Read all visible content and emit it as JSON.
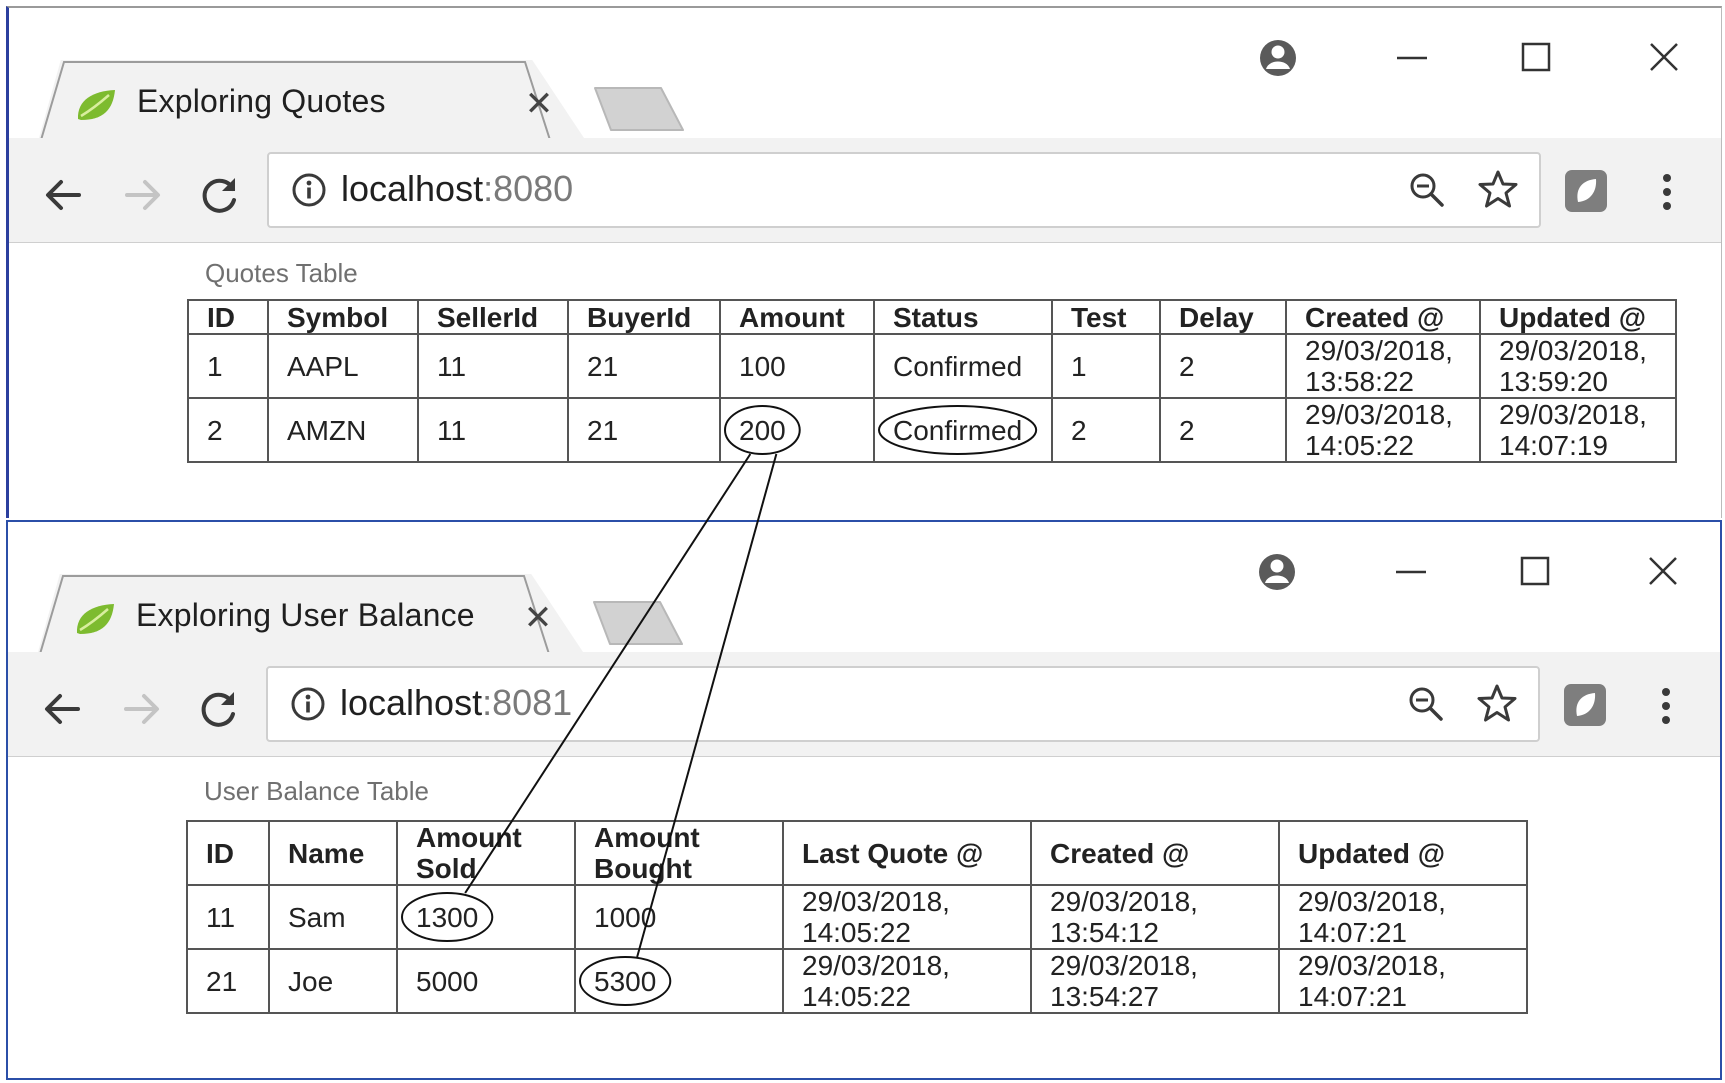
{
  "windows": [
    {
      "tab": {
        "title": "Exploring Quotes"
      },
      "address": {
        "host": "localhost",
        "port": ":8080"
      },
      "caption": "Quotes Table",
      "columns": [
        "ID",
        "Symbol",
        "SellerId",
        "BuyerId",
        "Amount",
        "Status",
        "Test",
        "Delay",
        "Created @",
        "Updated @"
      ],
      "rows": [
        [
          "1",
          "AAPL",
          "11",
          "21",
          "100",
          "Confirmed",
          "1",
          "2",
          "29/03/2018, 13:58:22",
          "29/03/2018, 13:59:20"
        ],
        [
          "2",
          "AMZN",
          "11",
          "21",
          "200",
          "Confirmed",
          "2",
          "2",
          "29/03/2018, 14:05:22",
          "29/03/2018, 14:07:19"
        ]
      ]
    },
    {
      "tab": {
        "title": "Exploring User Balance"
      },
      "address": {
        "host": "localhost",
        "port": ":8081"
      },
      "caption": "User Balance Table",
      "columns": [
        "ID",
        "Name",
        "Amount Sold",
        "Amount Bought",
        "Last Quote @",
        "Created @",
        "Updated @"
      ],
      "rows": [
        [
          "11",
          "Sam",
          "1300",
          "1000",
          "29/03/2018, 14:05:22",
          "29/03/2018, 13:54:12",
          "29/03/2018, 14:07:21"
        ],
        [
          "21",
          "Joe",
          "5000",
          "5300",
          "29/03/2018, 14:05:22",
          "29/03/2018, 13:54:27",
          "29/03/2018, 14:07:21"
        ]
      ]
    }
  ],
  "annotation_targets": [
    {
      "from_table": "Quotes Table",
      "from_value": "200",
      "to_table": "User Balance Table",
      "to_value": "1300"
    },
    {
      "from_table": "Quotes Table",
      "from_value": "200",
      "to_table": "User Balance Table",
      "to_value": "5300"
    },
    {
      "from_table": "Quotes Table",
      "from_value": "Confirmed",
      "to_table": "",
      "to_value": ""
    }
  ],
  "icons": {
    "favicon": "spring-leaf-icon",
    "tab_close": "close-icon",
    "new_tab": "new-tab-icon",
    "account": "account-icon",
    "minimize": "minimize-icon",
    "maximize": "maximize-icon",
    "close_window": "close-window-icon",
    "back": "back-arrow-icon",
    "forward": "forward-arrow-icon",
    "reload": "reload-icon",
    "site_info": "info-icon",
    "zoom": "zoom-out-icon",
    "bookmark": "star-icon",
    "extension": "extension-icon",
    "menu": "menu-dots-icon"
  },
  "colors": {
    "favicon_green": "#7dbb2f",
    "port_grey": "#7a7a7a",
    "caption_grey": "#707070",
    "window_border": "#2b4fa8"
  }
}
